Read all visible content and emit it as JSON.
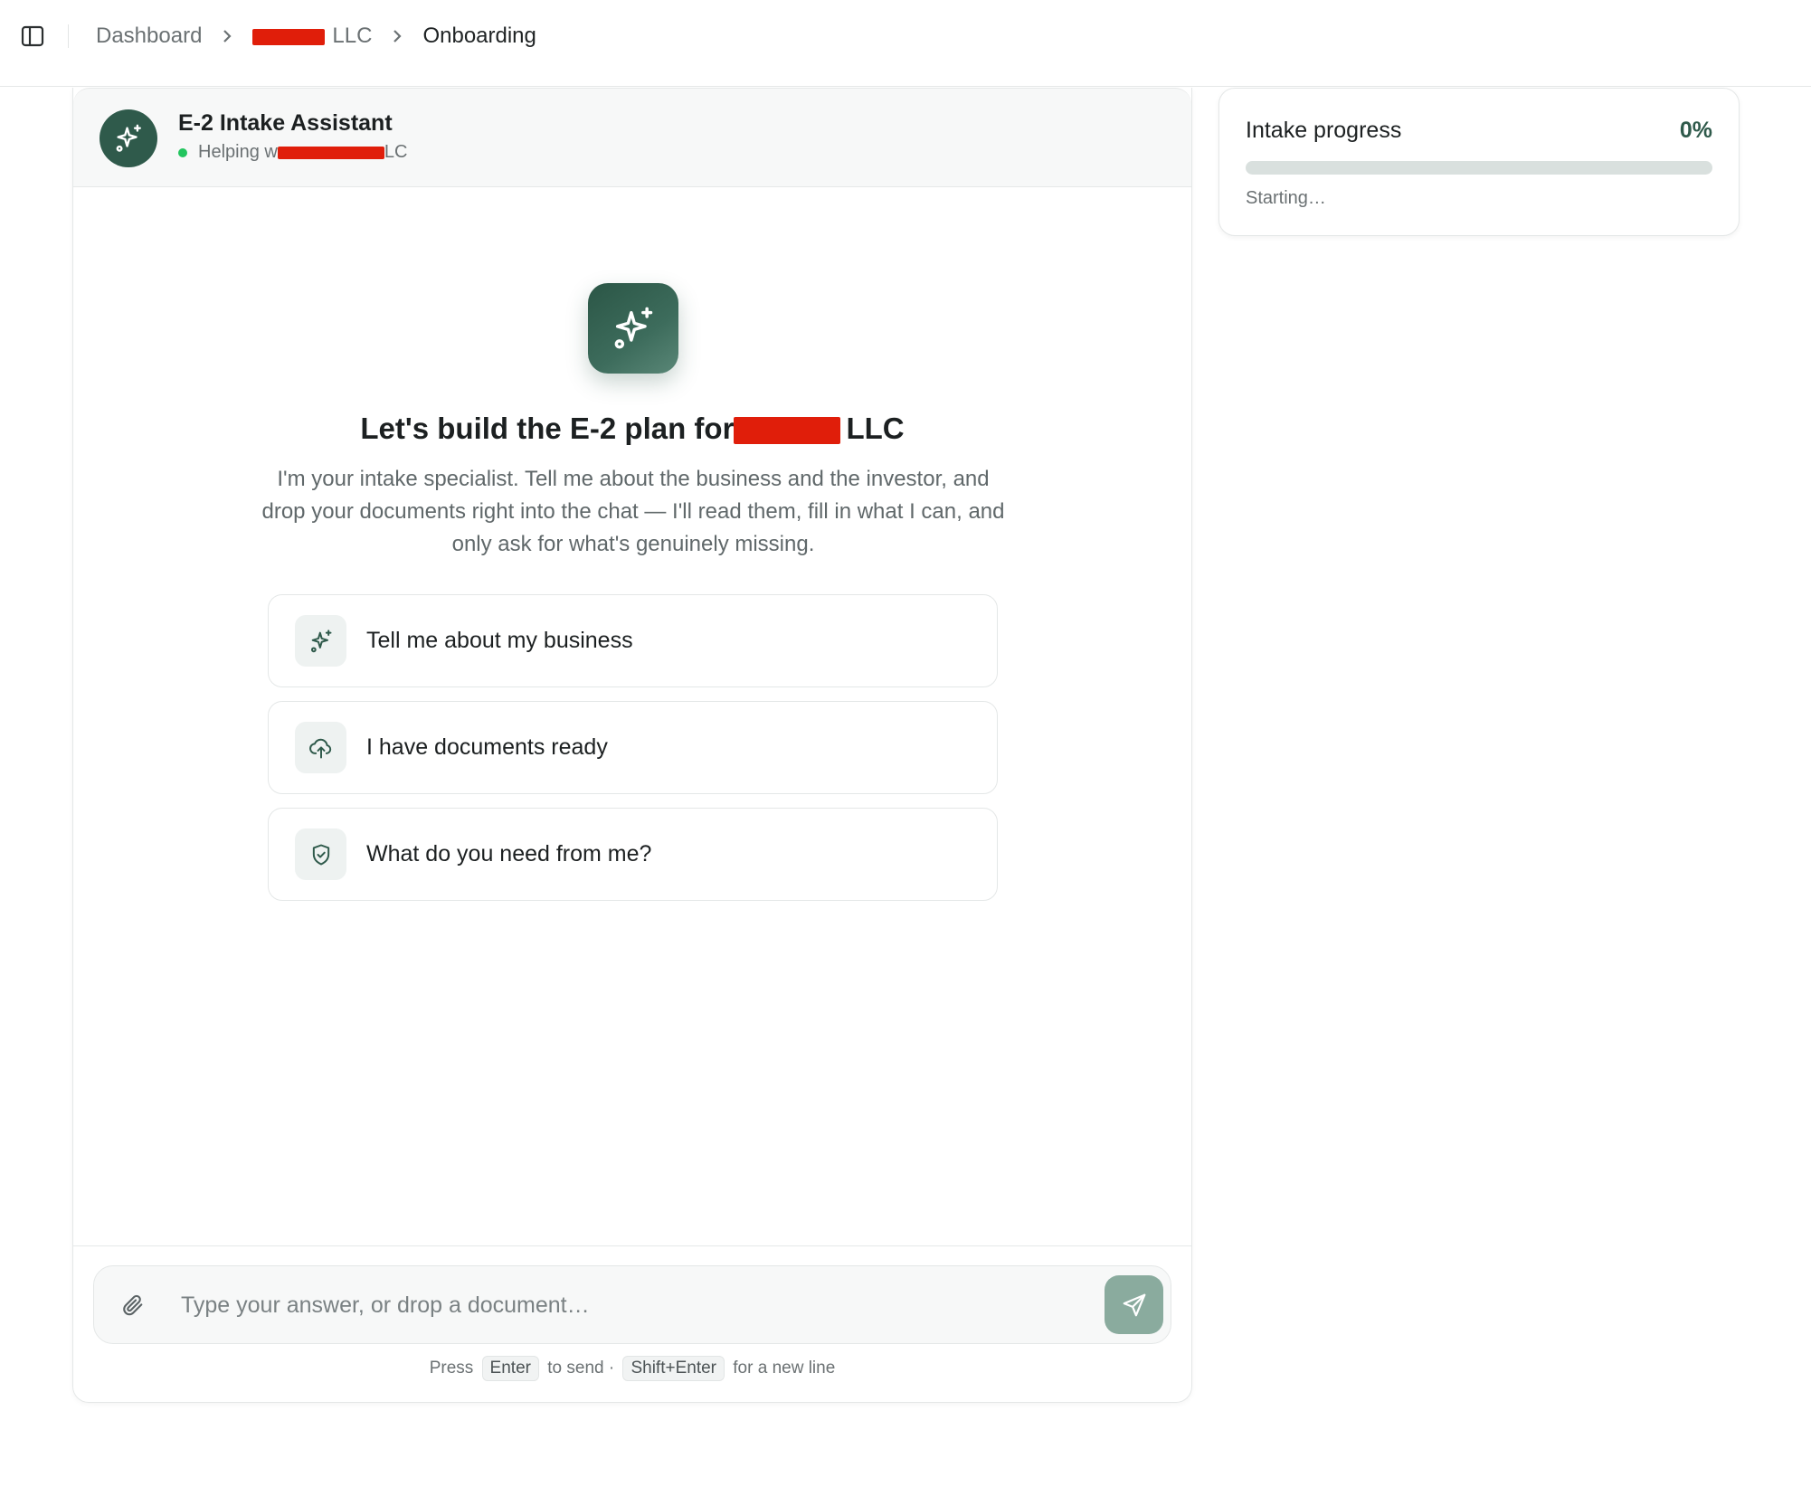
{
  "breadcrumb": {
    "items": [
      "Dashboard",
      "LLC",
      "Onboarding"
    ]
  },
  "chat": {
    "assistant_name": "E-2 Intake Assistant",
    "status_prefix": "Helping w",
    "status_suffix": "LC",
    "hero_title_prefix": "Let's build the E-2 plan for",
    "hero_title_suffix": "LLC",
    "hero_description": "I'm your intake specialist. Tell me about the business and the investor, and drop your documents right into the chat — I'll read them, fill in what I can, and only ask for what's genuinely missing.",
    "suggestions": [
      {
        "label": "Tell me about my business",
        "icon": "sparkles-icon"
      },
      {
        "label": "I have documents ready",
        "icon": "cloud-upload-icon"
      },
      {
        "label": "What do you need from me?",
        "icon": "shield-check-icon"
      }
    ],
    "input_placeholder": "Type your answer, or drop a document…",
    "hint": {
      "press": "Press",
      "enter_key": "Enter",
      "to_send": "to send ·",
      "shift_enter_key": "Shift+Enter",
      "new_line": "for a new line"
    }
  },
  "progress": {
    "title": "Intake progress",
    "percent_label": "0%",
    "value": 0,
    "status": "Starting…"
  },
  "colors": {
    "accent": "#2f5a4b",
    "send_button": "#8aab9e",
    "online": "#22c55e",
    "redaction": "#e01e0a"
  }
}
